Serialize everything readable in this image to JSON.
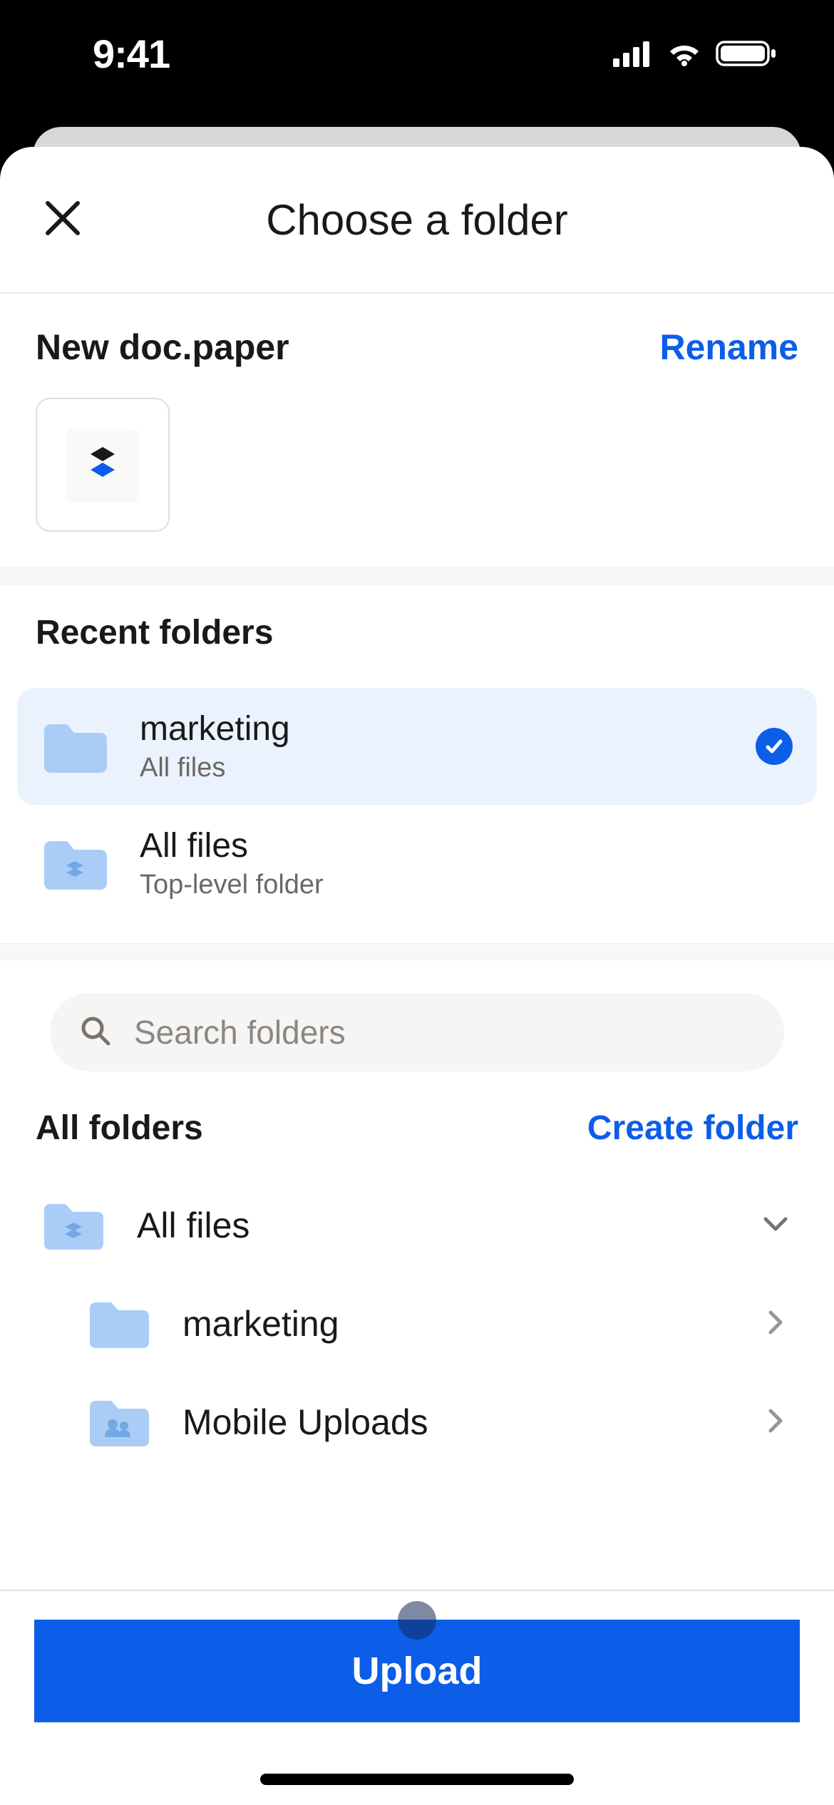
{
  "status": {
    "time": "9:41"
  },
  "header": {
    "title": "Choose a folder"
  },
  "file": {
    "name": "New doc.paper",
    "rename_label": "Rename"
  },
  "recent": {
    "title": "Recent folders",
    "items": [
      {
        "name": "marketing",
        "subtitle": "All files",
        "selected": true
      },
      {
        "name": "All files",
        "subtitle": "Top-level folder",
        "selected": false
      }
    ]
  },
  "search": {
    "placeholder": "Search folders"
  },
  "all_folders": {
    "title": "All folders",
    "create_label": "Create folder",
    "tree": {
      "root": {
        "label": "All files",
        "expanded": true
      },
      "children": [
        {
          "label": "marketing",
          "icon": "folder"
        },
        {
          "label": "Mobile Uploads",
          "icon": "shared-folder"
        }
      ]
    }
  },
  "upload_label": "Upload",
  "colors": {
    "accent": "#0c5ee8",
    "folder": "#a9cdf6"
  }
}
